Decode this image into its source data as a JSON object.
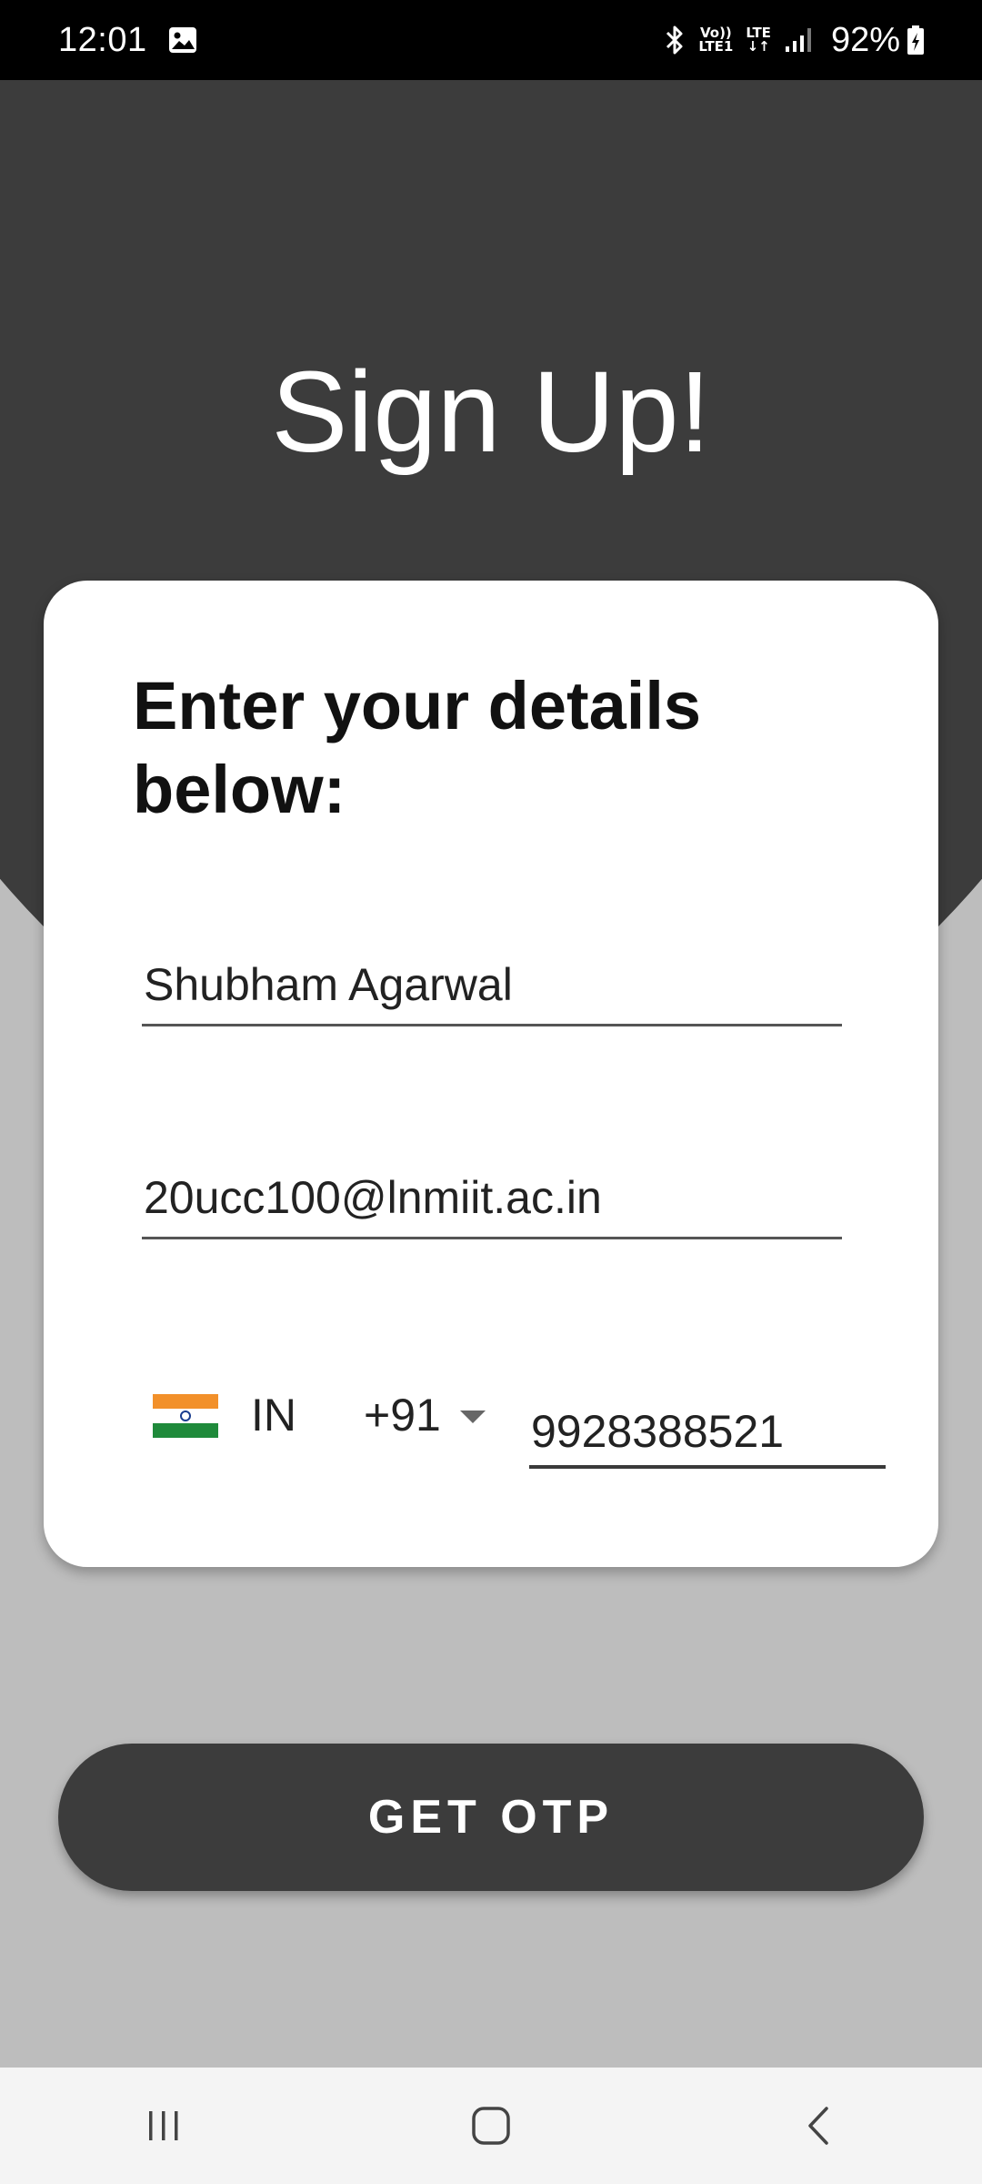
{
  "status_bar": {
    "time": "12:01",
    "icons": [
      "gallery-icon",
      "bluetooth-icon",
      "volte-icon",
      "lte-icon",
      "signal-icon",
      "battery-charging-icon"
    ],
    "volte_top": "Vo))",
    "volte_bottom": "LTE1",
    "lte_label": "LTE",
    "battery": "92%"
  },
  "header": {
    "title": "Sign Up!"
  },
  "form": {
    "heading": "Enter your details below:",
    "name_value": "Shubham Agarwal",
    "email_value": "20ucc100@lnmiit.ac.in",
    "country_code": "IN",
    "dial_code": "+91",
    "phone_value": "9928388521"
  },
  "actions": {
    "get_otp_label": "GET OTP"
  },
  "nav": {
    "icons": [
      "recent-apps-icon",
      "home-icon",
      "back-icon"
    ]
  },
  "colors": {
    "header_bg": "#3c3c3c",
    "page_bg": "#bdbdbd",
    "card_bg": "#ffffff",
    "button_bg": "#3c3c3c"
  }
}
